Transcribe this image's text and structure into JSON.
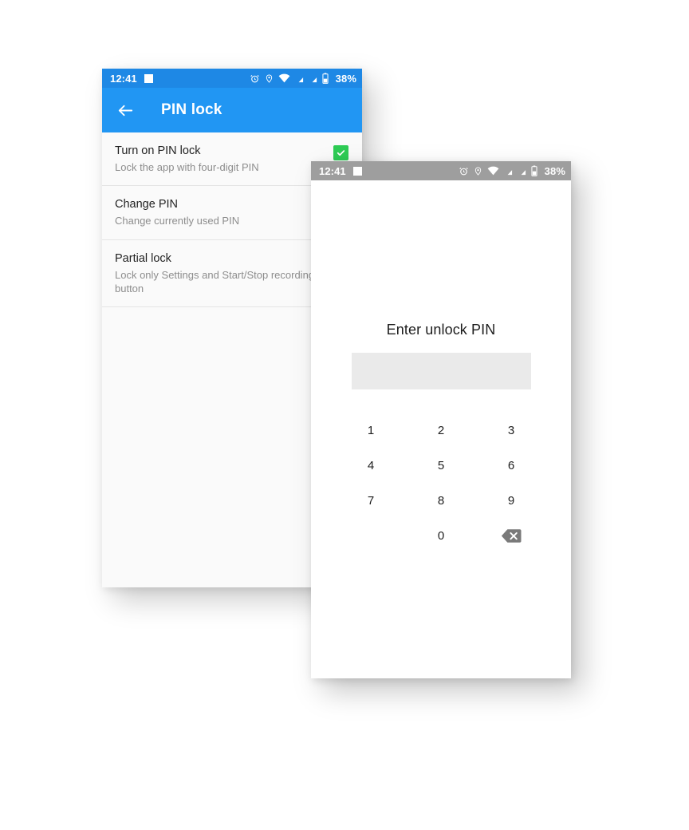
{
  "settings_screen": {
    "status_bar": {
      "time": "12:41",
      "battery_percent": "38%",
      "icons": [
        "screenshot-square-icon",
        "alarm-icon",
        "location-icon",
        "wifi-icon",
        "signal-1-icon",
        "signal-2-icon",
        "battery-icon"
      ],
      "background_color": "#1E88E5"
    },
    "toolbar": {
      "back_icon": "arrow-back-icon",
      "title": "PIN lock",
      "background_color": "#2196F3"
    },
    "items": [
      {
        "title": "Turn on PIN lock",
        "summary": "Lock the app with four-digit PIN",
        "widget": "checkbox",
        "checked": true,
        "checked_color": "#2ECC55"
      },
      {
        "title": "Change PIN",
        "summary": "Change currently used PIN",
        "widget": "none",
        "checked": false
      },
      {
        "title": "Partial lock",
        "summary": "Lock only Settings and Start/Stop recording button",
        "widget": "none",
        "checked": false
      }
    ]
  },
  "unlock_screen": {
    "status_bar": {
      "time": "12:41",
      "battery_percent": "38%",
      "icons": [
        "screenshot-square-icon",
        "alarm-icon",
        "location-icon",
        "wifi-icon",
        "signal-1-icon",
        "signal-2-icon",
        "battery-icon"
      ],
      "background_color": "#9E9E9E"
    },
    "title": "Enter unlock PIN",
    "pin_input": {
      "value": "",
      "placeholder": ""
    },
    "keypad": {
      "keys": [
        "1",
        "2",
        "3",
        "4",
        "5",
        "6",
        "7",
        "8",
        "9",
        "",
        "0",
        "backspace"
      ],
      "backspace_icon": "backspace-icon",
      "backspace_label": "⌫"
    }
  }
}
